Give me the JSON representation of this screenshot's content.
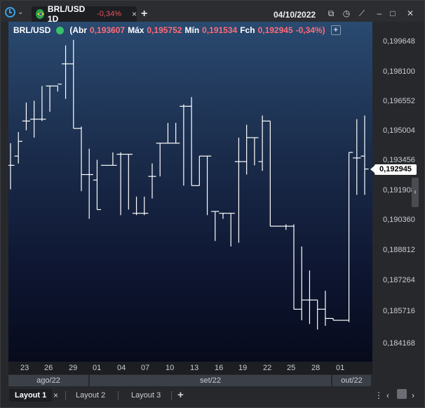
{
  "window": {
    "tab": {
      "symbol_label": "BRL/USD 1D",
      "change": "-0,34%",
      "close": "×"
    },
    "add_tab": "+",
    "date": "04/10/2022",
    "icons": [
      "window-icon",
      "clock-icon",
      "trend-icon",
      "minimize-icon",
      "maximize-icon",
      "close-icon"
    ]
  },
  "info": {
    "symbol": "BRL/USD",
    "open_label": "(Abr",
    "open": "0,193607",
    "high_label": "Máx",
    "high": "0,195752",
    "low_label": "Mín",
    "low": "0,191534",
    "close_label": "Fch",
    "close": "0,192945",
    "change": "-0,34%)",
    "add": "+"
  },
  "last_price": "0,192945",
  "chart_data": {
    "type": "ohlc",
    "ylim": [
      0.1836,
      0.2005
    ],
    "y_ticks": [
      "0,199648",
      "0,198100",
      "0,196552",
      "0,195004",
      "0,193456",
      "0,191908",
      "0,190360",
      "0,188812",
      "0,187264",
      "0,185716",
      "0,184168"
    ],
    "x_ticks": [
      "23",
      "26",
      "29",
      "01",
      "04",
      "07",
      "10",
      "13",
      "16",
      "19",
      "22",
      "25",
      "28",
      "01"
    ],
    "months": [
      "ago/22",
      "set/22",
      "out/22"
    ],
    "bars": [
      {
        "o": 0.1931,
        "h": 0.1943,
        "l": 0.1918,
        "c": 0.1931
      },
      {
        "o": 0.1936,
        "h": 0.1949,
        "l": 0.1932,
        "c": 0.1944
      },
      {
        "o": 0.1955,
        "h": 0.1965,
        "l": 0.195,
        "c": 0.1955
      },
      {
        "o": 0.1956,
        "h": 0.1966,
        "l": 0.1946,
        "c": 0.1956
      },
      {
        "o": 0.1956,
        "h": 0.1974,
        "l": 0.1955,
        "c": 0.1956
      },
      {
        "o": 0.1974,
        "h": 0.1974,
        "l": 0.196,
        "c": 0.1974
      },
      {
        "o": 0.1974,
        "h": 0.1974,
        "l": 0.1971,
        "c": 0.1975
      },
      {
        "o": 0.1986,
        "h": 0.1996,
        "l": 0.1967,
        "c": 0.1986
      },
      {
        "o": 0.1986,
        "h": 0.1999,
        "l": 0.1951,
        "c": 0.1951
      },
      {
        "o": 0.1951,
        "h": 0.1952,
        "l": 0.1917,
        "c": 0.1926
      },
      {
        "o": 0.1926,
        "h": 0.194,
        "l": 0.1902,
        "c": 0.1926
      },
      {
        "o": 0.1923,
        "h": 0.1934,
        "l": 0.1907,
        "c": 0.1907
      },
      {
        "o": 0.1931,
        "h": 0.1931,
        "l": 0.1931,
        "c": 0.1931
      },
      {
        "o": 0.1931,
        "h": 0.1938,
        "l": 0.1931,
        "c": 0.1931
      },
      {
        "o": 0.1937,
        "h": 0.1938,
        "l": 0.1904,
        "c": 0.1937
      },
      {
        "o": 0.1937,
        "h": 0.1937,
        "l": 0.1907,
        "c": 0.1937
      },
      {
        "o": 0.1905,
        "h": 0.1914,
        "l": 0.1904,
        "c": 0.1905
      },
      {
        "o": 0.1905,
        "h": 0.1914,
        "l": 0.1904,
        "c": 0.1905
      },
      {
        "o": 0.1925,
        "h": 0.1932,
        "l": 0.1913,
        "c": 0.1925
      },
      {
        "o": 0.1943,
        "h": 0.1943,
        "l": 0.1925,
        "c": 0.1943
      },
      {
        "o": 0.1943,
        "h": 0.1954,
        "l": 0.1943,
        "c": 0.1943
      },
      {
        "o": 0.1943,
        "h": 0.1954,
        "l": 0.1943,
        "c": 0.1943
      },
      {
        "o": 0.1963,
        "h": 0.1964,
        "l": 0.192,
        "c": 0.1963
      },
      {
        "o": 0.1963,
        "h": 0.1968,
        "l": 0.192,
        "c": 0.192
      },
      {
        "o": 0.192,
        "h": 0.1936,
        "l": 0.192,
        "c": 0.1936
      },
      {
        "o": 0.1936,
        "h": 0.1936,
        "l": 0.1904,
        "c": 0.1936
      },
      {
        "o": 0.1906,
        "h": 0.1906,
        "l": 0.189,
        "c": 0.1906
      },
      {
        "o": 0.1905,
        "h": 0.1905,
        "l": 0.1902,
        "c": 0.1905
      },
      {
        "o": 0.1905,
        "h": 0.1905,
        "l": 0.1887,
        "c": 0.1905
      },
      {
        "o": 0.1933,
        "h": 0.1946,
        "l": 0.1889,
        "c": 0.1933
      },
      {
        "o": 0.1933,
        "h": 0.1953,
        "l": 0.1926,
        "c": 0.1946
      },
      {
        "o": 0.1946,
        "h": 0.1946,
        "l": 0.1931,
        "c": 0.1946
      },
      {
        "o": 0.1933,
        "h": 0.1958,
        "l": 0.1928,
        "c": 0.1955
      },
      {
        "o": 0.1955,
        "h": 0.1955,
        "l": 0.1898,
        "c": 0.1898
      },
      {
        "o": 0.1898,
        "h": 0.1898,
        "l": 0.1898,
        "c": 0.1898
      },
      {
        "o": 0.1898,
        "h": 0.1899,
        "l": 0.1896,
        "c": 0.1898
      },
      {
        "o": 0.1898,
        "h": 0.1899,
        "l": 0.1853,
        "c": 0.1853
      },
      {
        "o": 0.1853,
        "h": 0.1887,
        "l": 0.1847,
        "c": 0.1858
      },
      {
        "o": 0.1858,
        "h": 0.1874,
        "l": 0.1845,
        "c": 0.1858
      },
      {
        "o": 0.1858,
        "h": 0.1858,
        "l": 0.1842,
        "c": 0.1853
      },
      {
        "o": 0.1853,
        "h": 0.1863,
        "l": 0.1844,
        "c": 0.1848
      },
      {
        "o": 0.1848,
        "h": 0.1848,
        "l": 0.1847,
        "c": 0.1847
      },
      {
        "o": 0.1847,
        "h": 0.1847,
        "l": 0.1847,
        "c": 0.1847
      },
      {
        "o": 0.1847,
        "h": 0.1938,
        "l": 0.1846,
        "c": 0.1938
      },
      {
        "o": 0.1935,
        "h": 0.1956,
        "l": 0.1915,
        "c": 0.1935
      },
      {
        "o": 0.1936,
        "h": 0.1958,
        "l": 0.1915,
        "c": 0.1929
      }
    ]
  },
  "bottom": {
    "tabs": [
      "Layout 1",
      "Layout 2",
      "Layout 3"
    ],
    "close": "×",
    "add": "+",
    "nav": "‹"
  }
}
